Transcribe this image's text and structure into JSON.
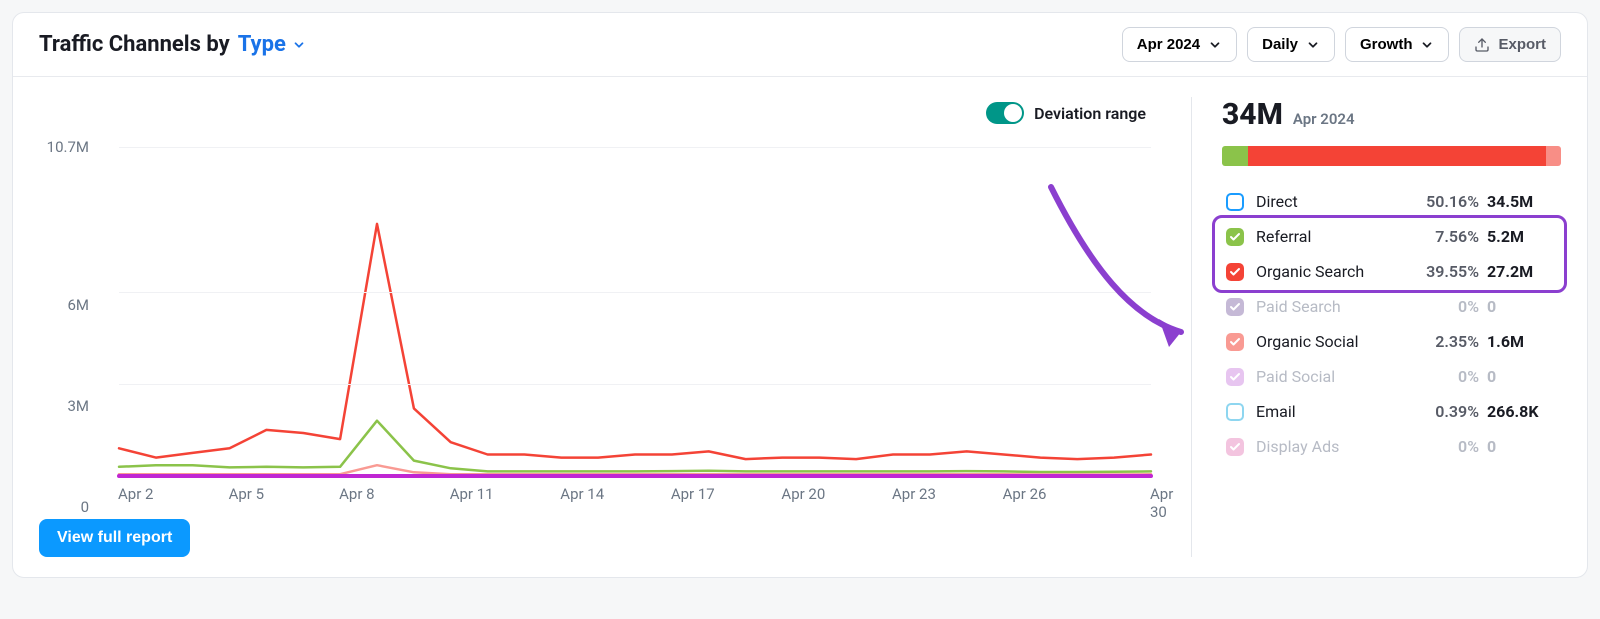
{
  "header": {
    "title_prefix": "Traffic Channels by",
    "title_type": "Type",
    "date_label": "Apr 2024",
    "granularity": "Daily",
    "metric": "Growth",
    "export_label": "Export"
  },
  "toggles": {
    "deviation_label": "Deviation range"
  },
  "summary": {
    "total": "34M",
    "total_period": "Apr 2024"
  },
  "stacked_bar": [
    {
      "color": "#8bc34a",
      "percent": 7.56
    },
    {
      "color": "#f44336",
      "percent": 88.0
    },
    {
      "color": "#f88e86",
      "percent": 4.44
    }
  ],
  "legend": [
    {
      "key": "direct",
      "label": "Direct",
      "percent": "50.16%",
      "value": "34.5M",
      "color": "#1a9cff",
      "checked": false,
      "muted": false,
      "outline": true
    },
    {
      "key": "referral",
      "label": "Referral",
      "percent": "7.56%",
      "value": "5.2M",
      "color": "#8bc34a",
      "checked": true,
      "muted": false,
      "outline": false
    },
    {
      "key": "organic-search",
      "label": "Organic Search",
      "percent": "39.55%",
      "value": "27.2M",
      "color": "#f44336",
      "checked": true,
      "muted": false,
      "outline": false
    },
    {
      "key": "paid-search",
      "label": "Paid Search",
      "percent": "0%",
      "value": "0",
      "color": "#c5b9d6",
      "checked": true,
      "muted": true,
      "outline": false
    },
    {
      "key": "organic-social",
      "label": "Organic Social",
      "percent": "2.35%",
      "value": "1.6M",
      "color": "#f99a93",
      "checked": true,
      "muted": false,
      "outline": false
    },
    {
      "key": "paid-social",
      "label": "Paid Social",
      "percent": "0%",
      "value": "0",
      "color": "#e7c5f0",
      "checked": true,
      "muted": true,
      "outline": false
    },
    {
      "key": "email",
      "label": "Email",
      "percent": "0.39%",
      "value": "266.8K",
      "color": "#8ed6f0",
      "checked": false,
      "muted": false,
      "outline": true
    },
    {
      "key": "display-ads",
      "label": "Display Ads",
      "percent": "0%",
      "value": "0",
      "color": "#f3c4df",
      "checked": true,
      "muted": true,
      "outline": false
    }
  ],
  "buttons": {
    "view_report": "View full report"
  },
  "chart_data": {
    "type": "line",
    "title": "Traffic Channels by Type",
    "xlabel": "",
    "ylabel": "",
    "ylim": [
      0,
      10700000
    ],
    "y_ticks": [
      0,
      3000000,
      6000000,
      10700000
    ],
    "y_tick_labels": [
      "0",
      "3M",
      "6M",
      "10.7M"
    ],
    "x_tick_labels": [
      "Apr 2",
      "Apr 5",
      "Apr 8",
      "Apr 11",
      "Apr 14",
      "Apr 17",
      "Apr 20",
      "Apr 23",
      "Apr 26",
      "Apr 30"
    ],
    "x_tick_idx": [
      0,
      3,
      6,
      9,
      12,
      15,
      18,
      21,
      24,
      28
    ],
    "x_labels": [
      "Apr 2",
      "Apr 3",
      "Apr 4",
      "Apr 5",
      "Apr 6",
      "Apr 7",
      "Apr 8",
      "Apr 9",
      "Apr 10",
      "Apr 11",
      "Apr 12",
      "Apr 13",
      "Apr 14",
      "Apr 15",
      "Apr 16",
      "Apr 17",
      "Apr 18",
      "Apr 19",
      "Apr 20",
      "Apr 21",
      "Apr 22",
      "Apr 23",
      "Apr 24",
      "Apr 25",
      "Apr 26",
      "Apr 27",
      "Apr 28",
      "Apr 29",
      "Apr 30"
    ],
    "series": [
      {
        "name": "Organic Search",
        "color": "#f44336",
        "values": [
          900000,
          600000,
          750000,
          900000,
          1500000,
          1400000,
          1200000,
          8200000,
          2200000,
          1100000,
          700000,
          700000,
          600000,
          600000,
          700000,
          700000,
          800000,
          550000,
          600000,
          600000,
          550000,
          700000,
          700000,
          800000,
          700000,
          600000,
          550000,
          600000,
          700000
        ]
      },
      {
        "name": "Referral",
        "color": "#8bc34a",
        "values": [
          300000,
          350000,
          350000,
          280000,
          300000,
          280000,
          300000,
          1800000,
          500000,
          250000,
          150000,
          150000,
          150000,
          150000,
          150000,
          160000,
          170000,
          150000,
          150000,
          150000,
          150000,
          150000,
          150000,
          160000,
          150000,
          130000,
          130000,
          140000,
          150000
        ]
      },
      {
        "name": "Organic Social",
        "color": "#f99a93",
        "values": [
          60000,
          60000,
          60000,
          60000,
          60000,
          60000,
          60000,
          350000,
          120000,
          60000,
          55000,
          55000,
          55000,
          55000,
          55000,
          55000,
          55000,
          55000,
          55000,
          55000,
          55000,
          55000,
          55000,
          55000,
          55000,
          50000,
          50000,
          50000,
          55000
        ]
      },
      {
        "name": "Zero baseline",
        "color": "#c026d3",
        "values": [
          0,
          0,
          0,
          0,
          0,
          0,
          0,
          0,
          0,
          0,
          0,
          0,
          0,
          0,
          0,
          0,
          0,
          0,
          0,
          0,
          0,
          0,
          0,
          0,
          0,
          0,
          0,
          0,
          0
        ]
      }
    ]
  }
}
